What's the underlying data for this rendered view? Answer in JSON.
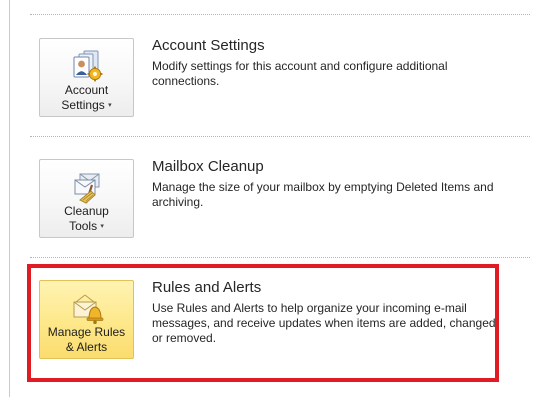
{
  "sections": [
    {
      "id": "account",
      "button_line1": "Account",
      "button_line2": "Settings",
      "title": "Account Settings",
      "description": "Modify settings for this account and configure additional connections."
    },
    {
      "id": "mailbox",
      "button_line1": "Cleanup",
      "button_line2": "Tools",
      "title": "Mailbox Cleanup",
      "description": "Manage the size of your mailbox by emptying Deleted Items and archiving."
    },
    {
      "id": "rules",
      "button_line1": "Manage Rules",
      "button_line2": "& Alerts",
      "title": "Rules and Alerts",
      "description": "Use Rules and Alerts to help organize your incoming e-mail messages, and receive updates when items are added, changed, or removed."
    }
  ],
  "icons": {
    "account": "account-settings-icon",
    "mailbox": "cleanup-tools-icon",
    "rules": "manage-rules-alerts-icon"
  },
  "colors": {
    "highlight_border": "#e01b24",
    "active_tile": "#fde98d"
  },
  "dropdown_caret": "▾"
}
